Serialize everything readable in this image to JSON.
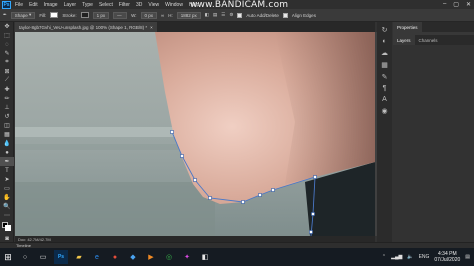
{
  "watermark": "www.BANDICAM.com",
  "menubar": {
    "logo": "Ps",
    "items": [
      "File",
      "Edit",
      "Image",
      "Layer",
      "Type",
      "Select",
      "Filter",
      "3D",
      "View",
      "Window",
      "Help"
    ]
  },
  "options": {
    "mode": "Shape",
    "fill_label": "Fill:",
    "stroke_label": "Stroke:",
    "stroke_width": "1 px",
    "w_label": "W:",
    "w_value": "0 px",
    "h_label": "H:",
    "h_value": "1882 px",
    "auto_add_delete": "Auto Add/Delete",
    "align_edges": "Align Edges"
  },
  "document": {
    "tab_title": "taylor-8gb7Gvhi_VeU-unsplash.jpg @ 100% (Shape 1, RGB/8) *",
    "close_glyph": "×"
  },
  "status": {
    "text": "Doc: 42.7M/42.7M"
  },
  "timeline": {
    "label": "Timeline"
  },
  "panel": {
    "tabs": [
      "Properties",
      "Layers",
      "Channels"
    ],
    "active_tab": "Properties"
  },
  "taskbar": {
    "time": "4:34 PM",
    "date": "07/Jul/2020",
    "lang": "ENG"
  },
  "colors": {
    "accent": "#31a8ff",
    "path": "#4a78c8"
  }
}
